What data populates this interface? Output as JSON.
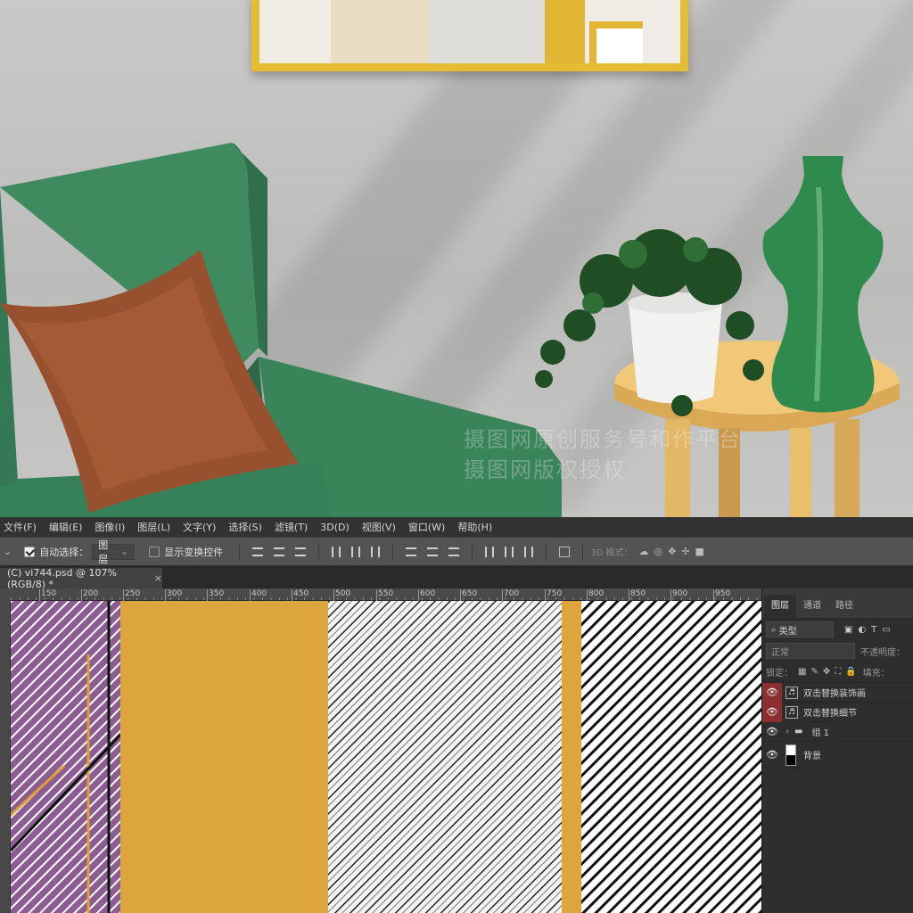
{
  "watermark": {
    "line1": "摄图网原创服务号和作平台",
    "line2": "摄图网版权授权"
  },
  "menu": [
    "文件(F)",
    "编辑(E)",
    "图像(I)",
    "图层(L)",
    "文字(Y)",
    "选择(S)",
    "滤镜(T)",
    "3D(D)",
    "视图(V)",
    "窗口(W)",
    "帮助(H)"
  ],
  "options": {
    "auto_select_label": "自动选择：",
    "auto_select_value": "图层",
    "show_transform_label": "显示变换控件",
    "mode_3d_label": "3D 模式："
  },
  "document_tab": {
    "title": "(C) vi744.psd @ 107%(RGB/8) *",
    "close": "×"
  },
  "ruler_ticks": [
    "150",
    "200",
    "250",
    "300",
    "350",
    "400",
    "450",
    "500",
    "550",
    "600",
    "650",
    "700",
    "750",
    "800",
    "850",
    "900",
    "950"
  ],
  "layers_panel": {
    "tabs": [
      "图层",
      "通道",
      "路径"
    ],
    "filter_value": "类型",
    "blend_mode": "正常",
    "opacity_label": "不透明度：",
    "lock_label": "锁定：",
    "fill_label": "填充：",
    "layers": [
      {
        "name": "双击替换装饰画",
        "highlight": true,
        "type": "smart"
      },
      {
        "name": "双击替换细节",
        "highlight": true,
        "type": "smart"
      },
      {
        "name": "组 1",
        "highlight": false,
        "type": "group"
      },
      {
        "name": "背景",
        "highlight": false,
        "type": "background"
      }
    ]
  },
  "colors": {
    "mustard": "#dca63c",
    "purple": "#8c5d93",
    "accent_red": "#8c2f2f",
    "chair_green": "#3d8a5e",
    "pillow_brown": "#9a5230"
  }
}
